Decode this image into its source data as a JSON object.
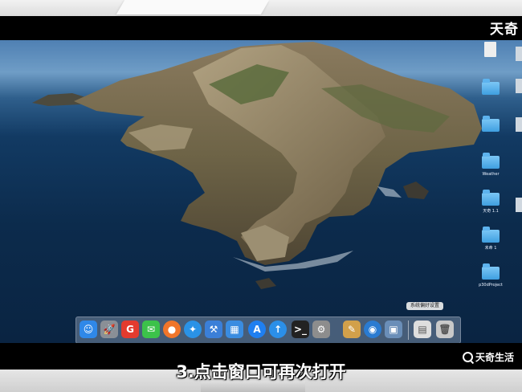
{
  "watermark_top": "天奇",
  "watermark_bottom": "天奇生活",
  "caption": "3.点击窗口可再次打开",
  "tooltip": "系统偏好设置",
  "desktop_items": [
    {
      "label": "",
      "icon": "file-icon"
    },
    {
      "label": "",
      "icon": "folder-icon"
    },
    {
      "label": "",
      "icon": "folder-icon"
    },
    {
      "label": "Weather",
      "icon": "folder-icon"
    },
    {
      "label": "天奇 1.1",
      "icon": "folder-icon"
    },
    {
      "label": "未命 1",
      "icon": "folder-icon"
    },
    {
      "label": "p30dProject",
      "icon": "folder-icon"
    }
  ],
  "dock": [
    {
      "name": "finder-icon",
      "color": "#2f88e8",
      "glyph": "☺"
    },
    {
      "name": "launchpad-icon",
      "color": "#8a8f96",
      "glyph": "🚀"
    },
    {
      "name": "google-browser-icon",
      "color": "#e33b2e",
      "glyph": "G"
    },
    {
      "name": "wechat-icon",
      "color": "#3cc24a",
      "glyph": "✉"
    },
    {
      "name": "firefox-icon",
      "color": "#f0752a",
      "glyph": "●"
    },
    {
      "name": "safari-icon",
      "color": "#2a92e6",
      "glyph": "✦"
    },
    {
      "name": "xcode-tools-icon",
      "color": "#3b7fd8",
      "glyph": "⚒"
    },
    {
      "name": "files-icon",
      "color": "#3a8ce0",
      "glyph": "▦"
    },
    {
      "name": "app-store-icon",
      "color": "#1f7ff0",
      "glyph": "A"
    },
    {
      "name": "upload-icon",
      "color": "#2b8fe8",
      "glyph": "↑"
    },
    {
      "name": "terminal-icon",
      "color": "#222222",
      "glyph": ">_"
    },
    {
      "name": "system-preferences-gear-icon",
      "color": "#8d8d8d",
      "glyph": "⚙"
    },
    {
      "name": "notes-icon",
      "color": "#d2a04a",
      "glyph": "✎"
    },
    {
      "name": "network-globe-icon",
      "color": "#2a7bd1",
      "glyph": "◉"
    },
    {
      "name": "image-preview-icon",
      "color": "#6a8eb8",
      "glyph": "▣"
    },
    {
      "name": "documents-stack-icon",
      "color": "#dedede",
      "glyph": "▤"
    },
    {
      "name": "trash-icon",
      "color": "#c9c9c9",
      "glyph": "🗑"
    }
  ]
}
